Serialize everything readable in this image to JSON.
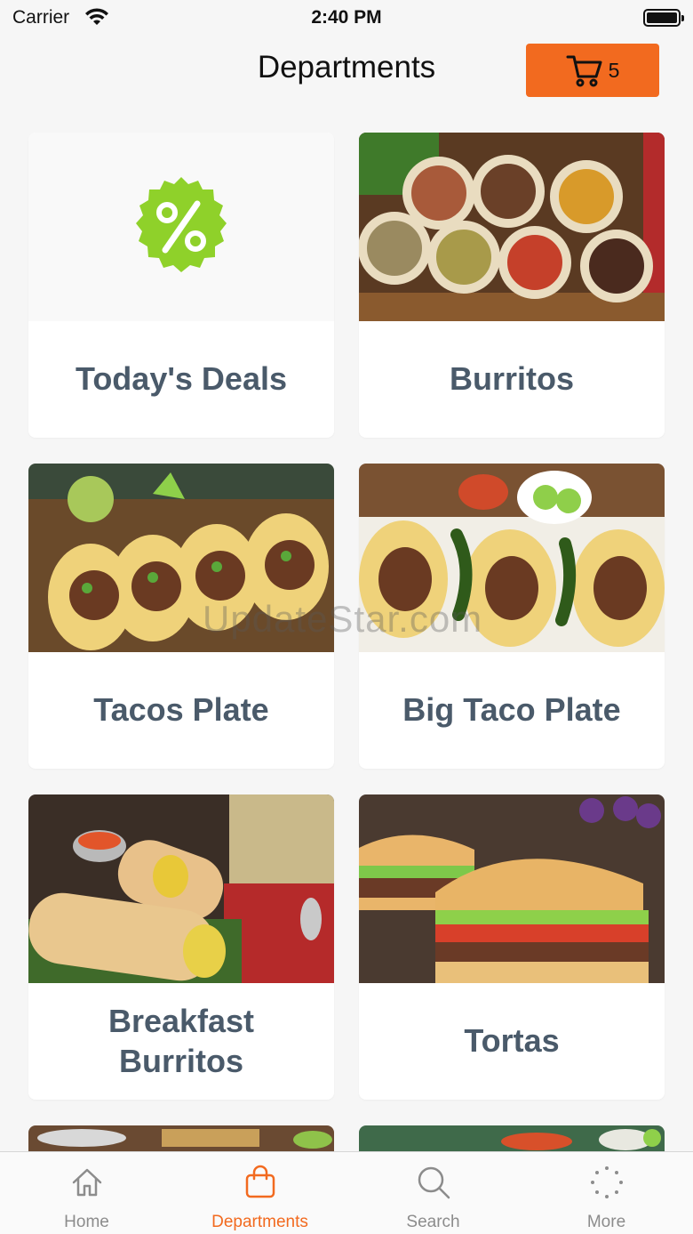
{
  "status_bar": {
    "carrier": "Carrier",
    "time": "2:40 PM"
  },
  "header": {
    "title": "Departments",
    "cart_count": "5"
  },
  "departments": [
    {
      "label": "Today's Deals",
      "image": "percent-badge-icon"
    },
    {
      "label": "Burritos",
      "image": "burritos-photo"
    },
    {
      "label": "Tacos Plate",
      "image": "tacos-plate-photo"
    },
    {
      "label": "Big Taco Plate",
      "image": "big-taco-plate-photo"
    },
    {
      "label": "Breakfast Burritos",
      "image": "breakfast-burritos-photo"
    },
    {
      "label": "Tortas",
      "image": "tortas-photo"
    }
  ],
  "watermark": "UpdateStar.com",
  "tabs": [
    {
      "label": "Home",
      "icon": "home-icon",
      "active": false
    },
    {
      "label": "Departments",
      "icon": "bag-icon",
      "active": true
    },
    {
      "label": "Search",
      "icon": "search-icon",
      "active": false
    },
    {
      "label": "More",
      "icon": "more-icon",
      "active": false
    }
  ],
  "colors": {
    "accent": "#f26a1f",
    "deals_badge": "#8fd12a",
    "label_text": "#4a5a6a"
  }
}
